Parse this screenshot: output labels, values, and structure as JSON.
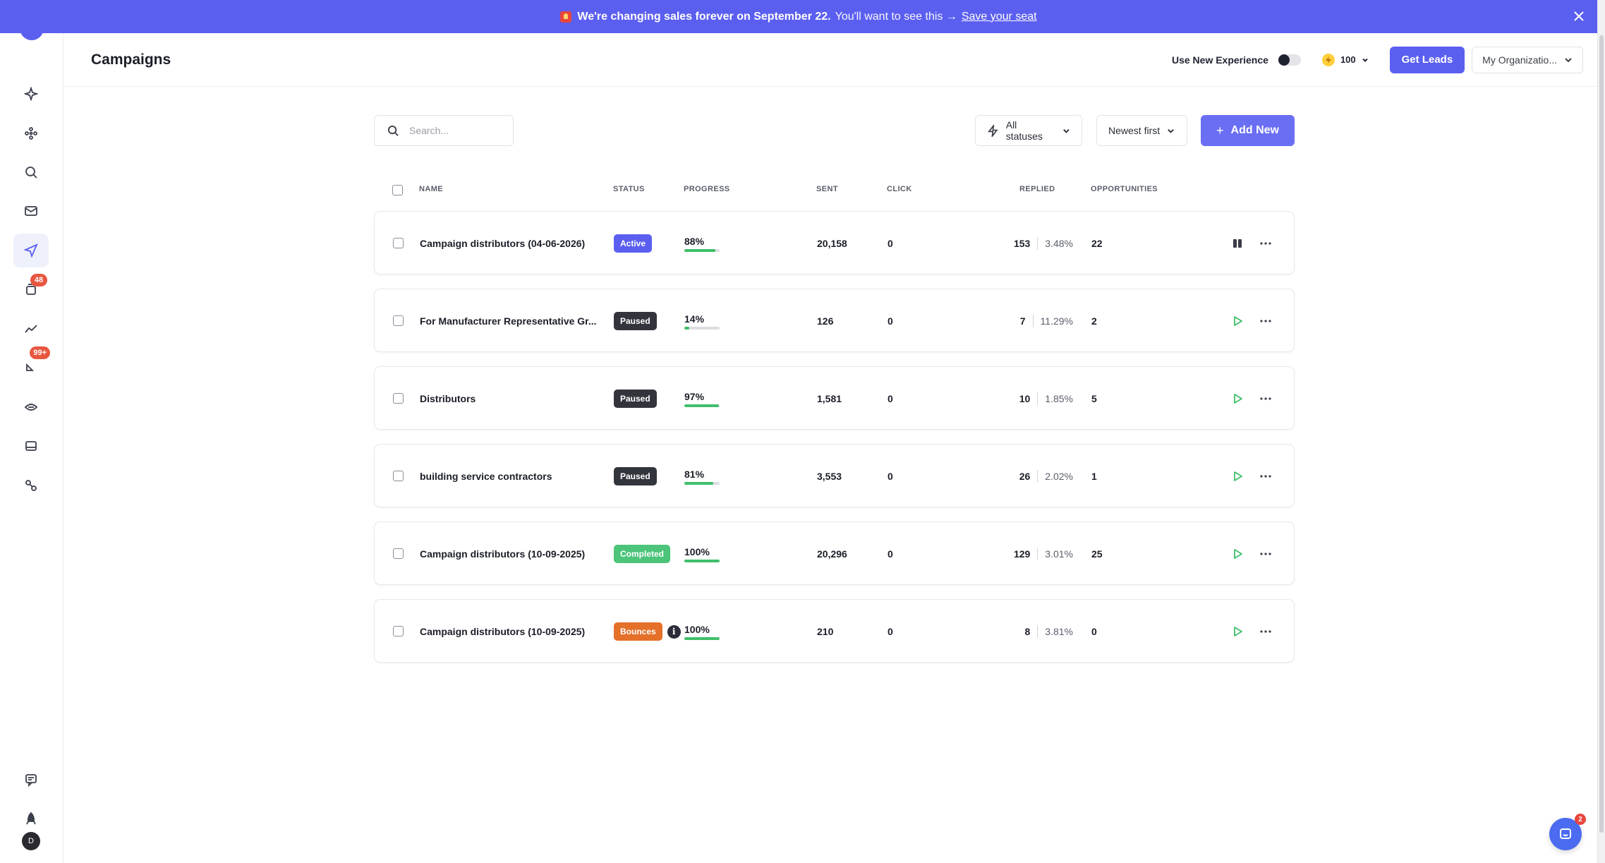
{
  "banner": {
    "headline": "We're changing sales forever on September 22.",
    "subtext": "You'll want to see this →",
    "link": "Save your seat"
  },
  "sidebar": {
    "items": [
      {
        "name": "sparkle-icon"
      },
      {
        "name": "hub-icon"
      },
      {
        "name": "search-icon"
      },
      {
        "name": "mail-icon"
      },
      {
        "name": "send-icon",
        "active": true
      },
      {
        "name": "inbox-stack-icon",
        "badge": "48"
      },
      {
        "name": "analytics-icon"
      },
      {
        "name": "chat-tag-icon",
        "badge": "99+"
      },
      {
        "name": "crm-icon"
      },
      {
        "name": "inbox-icon"
      },
      {
        "name": "integrations-icon"
      },
      {
        "name": "feedback-icon"
      },
      {
        "name": "rocket-icon"
      }
    ],
    "avatar_initial": "D"
  },
  "header": {
    "title": "Campaigns",
    "toggle_label": "Use New Experience",
    "credits": "100",
    "get_leads": "Get Leads",
    "org": "My Organizatio..."
  },
  "toolbar": {
    "search_placeholder": "Search...",
    "status_filter": "All statuses",
    "sort": "Newest first",
    "add_new": "Add New"
  },
  "table": {
    "columns": [
      "NAME",
      "STATUS",
      "PROGRESS",
      "SENT",
      "CLICK",
      "REPLIED",
      "OPPORTUNITIES"
    ],
    "rows": [
      {
        "name": "Campaign distributors (04-06-2026)",
        "status": "Active",
        "status_color": "#5b5ff0",
        "progress": "88%",
        "progress_value": 0.88,
        "sent": "20,158",
        "click": "0",
        "replied": "153",
        "reply_rate": "3.48%",
        "opportunities": "22",
        "action": "pause"
      },
      {
        "name": "For Manufacturer Representative Gr...",
        "status": "Paused",
        "status_color": "#33353d",
        "progress": "14%",
        "progress_value": 0.14,
        "sent": "126",
        "click": "0",
        "replied": "7",
        "reply_rate": "11.29%",
        "opportunities": "2",
        "action": "play"
      },
      {
        "name": "Distributors",
        "status": "Paused",
        "status_color": "#33353d",
        "progress": "97%",
        "progress_value": 0.97,
        "sent": "1,581",
        "click": "0",
        "replied": "10",
        "reply_rate": "1.85%",
        "opportunities": "5",
        "action": "play"
      },
      {
        "name": "building service contractors",
        "status": "Paused",
        "status_color": "#33353d",
        "progress": "81%",
        "progress_value": 0.81,
        "sent": "3,553",
        "click": "0",
        "replied": "26",
        "reply_rate": "2.02%",
        "opportunities": "1",
        "action": "play"
      },
      {
        "name": "Campaign distributors (10-09-2025)",
        "status": "Completed",
        "status_color": "#4cc47a",
        "progress": "100%",
        "progress_value": 1.0,
        "sent": "20,296",
        "click": "0",
        "replied": "129",
        "reply_rate": "3.01%",
        "opportunities": "25",
        "action": "play"
      },
      {
        "name": "Campaign distributors (10-09-2025)",
        "status": "Bounces",
        "status_color": "#e5702a",
        "progress": "100%",
        "progress_value": 1.0,
        "sent": "210",
        "click": "0",
        "replied": "8",
        "reply_rate": "3.81%",
        "opportunities": "0",
        "action": "play",
        "has_info": true
      }
    ]
  },
  "chat": {
    "badge": "2"
  },
  "colors": {
    "accent": "#5b5ff0",
    "progress": "#3fbf6a",
    "play": "#3fbf6a"
  }
}
